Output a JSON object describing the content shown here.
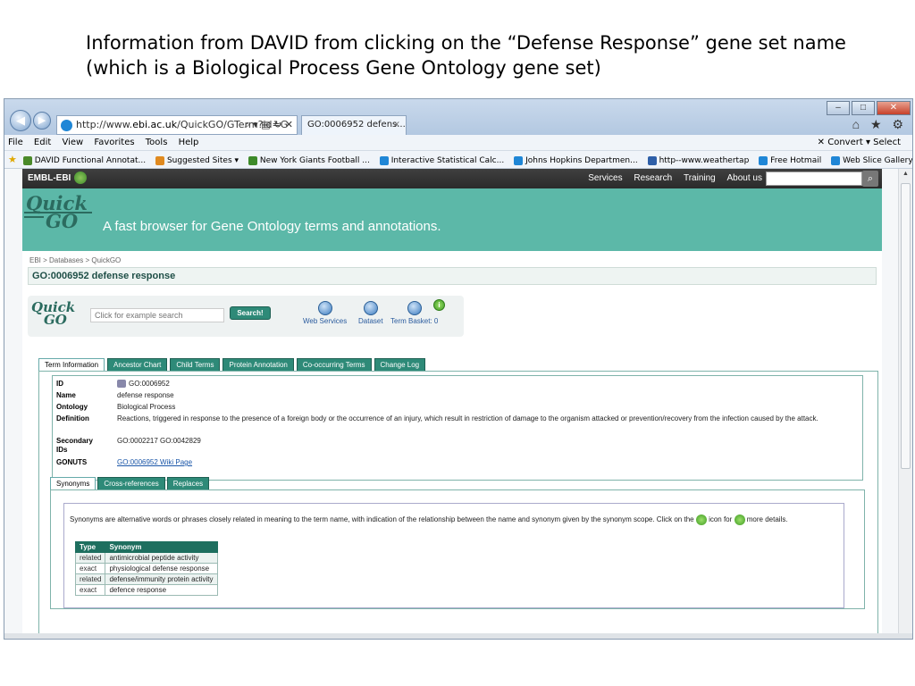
{
  "slide": {
    "title_line1": "Information from DAVID from clicking on the “Defense Response” gene set name",
    "title_line2": "(which is a Biological Process Gene Ontology gene set)"
  },
  "browser": {
    "address": "http://www.",
    "address_domain": "ebi.ac.uk",
    "address_rest": "/QuickGO/GTerm?id=G",
    "address_tools": "⌕ ▾ ▤ ↻ ✕",
    "tab_title": "GO:0006952 defens...",
    "tab_close": "×",
    "window_controls": [
      "–",
      "□",
      "✕"
    ],
    "right_icons": "⌂ ★ ⚙",
    "menu": [
      "File",
      "Edit",
      "View",
      "Favorites",
      "Tools",
      "Help"
    ],
    "menu_right": "✕   Convert ▾  Select",
    "favorites": [
      {
        "label": "DAVID Functional Annotat...",
        "color": "#4a8a2a"
      },
      {
        "label": "Suggested Sites ▾",
        "color": "#e08a20"
      },
      {
        "label": "New York Giants Football ...",
        "color": "#3d8a2a"
      },
      {
        "label": "Interactive Statistical Calc...",
        "color": "#1f86d6"
      },
      {
        "label": "Johns Hopkins Departmen...",
        "color": "#1f86d6"
      },
      {
        "label": "http--www.weathertap",
        "color": "#2e5fa8"
      },
      {
        "label": "Free Hotmail",
        "color": "#1f86d6"
      },
      {
        "label": "Web Slice Gallery ▾",
        "color": "#1f86d6"
      }
    ]
  },
  "ebi": {
    "logo": "EMBL-EBI",
    "nav": [
      "Services",
      "Research",
      "Training",
      "About us"
    ],
    "search_icon": "⌕"
  },
  "banner": {
    "logo_top": "Quick",
    "logo_bottom": "GO",
    "tagline": "A fast browser for Gene Ontology terms and annotations."
  },
  "breadcrumb": "EBI > Databases > QuickGO",
  "term_heading": "GO:0006952 defense response",
  "quicksearch": {
    "placeholder": "Click for example search",
    "button": "Search!",
    "tools": [
      "Web Services",
      "Dataset",
      "Term Basket: 0"
    ],
    "info": "i"
  },
  "tabs": [
    "Term Information",
    "Ancestor Chart",
    "Child Terms",
    "Protein Annotation",
    "Co-occurring Terms",
    "Change Log"
  ],
  "term": {
    "id_label": "ID",
    "id_value": "GO:0006952",
    "name_label": "Name",
    "name_value": "defense response",
    "ontology_label": "Ontology",
    "ontology_value": "Biological Process",
    "definition_label": "Definition",
    "definition_value": "Reactions, triggered in response to the presence of a foreign body or the occurrence of an injury, which result in restriction of damage to the organism attacked or prevention/recovery from the infection caused by the attack.",
    "secondary_label": "Secondary IDs",
    "secondary_value": "GO:0002217  GO:0042829",
    "gonuts_label": "GONUTS",
    "gonuts_value": "GO:0006952 Wiki Page"
  },
  "subtabs": [
    "Synonyms",
    "Cross-references",
    "Replaces"
  ],
  "synonyms": {
    "desc_part1": "Synonyms are alternative words or phrases closely related in meaning to the term name, with indication of the relationship between the name and synonym given by the synonym scope. Click on the",
    "desc_part2": "icon for",
    "desc_part3": "more details.",
    "headers": [
      "Type",
      "Synonym"
    ],
    "rows": [
      {
        "type": "related",
        "synonym": "antimicrobial peptide activity"
      },
      {
        "type": "exact",
        "synonym": "physiological defense response"
      },
      {
        "type": "related",
        "synonym": "defense/immunity protein activity"
      },
      {
        "type": "exact",
        "synonym": "defence response"
      }
    ]
  }
}
